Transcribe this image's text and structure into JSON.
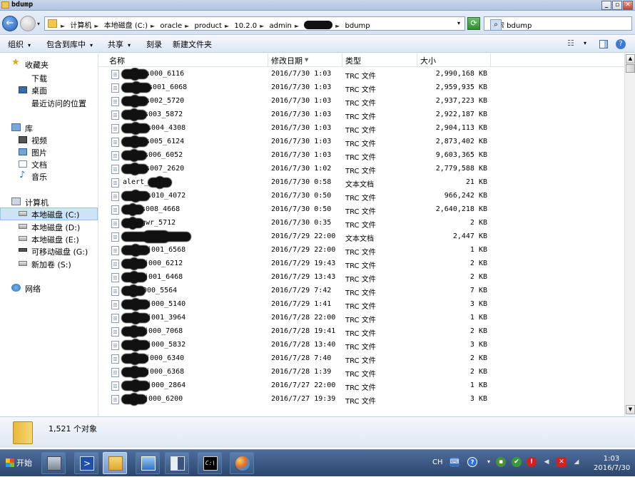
{
  "window": {
    "title": "bdump"
  },
  "address": {
    "crumbs": [
      "计算机",
      "本地磁盘 (C:)",
      "oracle",
      "product",
      "10.2.0",
      "admin",
      "",
      "bdump"
    ]
  },
  "search": {
    "placeholder": "搜索 bdump"
  },
  "toolbar": {
    "organize": "组织",
    "include_library": "包含到库中",
    "share": "共享",
    "burn": "刻录",
    "new_folder": "新建文件夹"
  },
  "sidebar": {
    "favorites": "收藏夹",
    "fav_items": [
      "下载",
      "桌面",
      "最近访问的位置"
    ],
    "libraries": "库",
    "lib_items": [
      "视频",
      "图片",
      "文档",
      "音乐"
    ],
    "computer": "计算机",
    "drives": [
      "本地磁盘 (C:)",
      "本地磁盘 (D:)",
      "本地磁盘 (E:)",
      "可移动磁盘 (G:)",
      "新加卷 (S:)"
    ],
    "network": "网络"
  },
  "columns": {
    "name": "名称",
    "date": "修改日期",
    "type": "类型",
    "size": "大小"
  },
  "files": [
    {
      "name": "s000_6116",
      "date": "2016/7/30 1:03",
      "type": "TRC 文件",
      "size": "2,990,168 KB"
    },
    {
      "name": "s001_6068",
      "date": "2016/7/30 1:03",
      "type": "TRC 文件",
      "size": "2,959,935 KB"
    },
    {
      "name": "s002_5720",
      "date": "2016/7/30 1:03",
      "type": "TRC 文件",
      "size": "2,937,223 KB"
    },
    {
      "name": "s003_5872",
      "date": "2016/7/30 1:03",
      "type": "TRC 文件",
      "size": "2,922,187 KB"
    },
    {
      "name": "s004_4308",
      "date": "2016/7/30 1:03",
      "type": "TRC 文件",
      "size": "2,904,113 KB"
    },
    {
      "name": "s005_6124",
      "date": "2016/7/30 1:03",
      "type": "TRC 文件",
      "size": "2,873,402 KB"
    },
    {
      "name": "s006_6052",
      "date": "2016/7/30 1:03",
      "type": "TRC 文件",
      "size": "9,603,365 KB"
    },
    {
      "name": "s007_2620",
      "date": "2016/7/30 1:02",
      "type": "TRC 文件",
      "size": "2,779,588 KB"
    },
    {
      "name": "alert_",
      "date": "2016/7/30 0:58",
      "type": "文本文档",
      "size": "21 KB"
    },
    {
      "name": "s010_4072",
      "date": "2016/7/30 0:50",
      "type": "TRC 文件",
      "size": "966,242 KB"
    },
    {
      "name": "s008_4668",
      "date": "2016/7/30 0:50",
      "type": "TRC 文件",
      "size": "2,640,218 KB"
    },
    {
      "name": "gwr_5712",
      "date": "2016/7/30 0:35",
      "type": "TRC 文件",
      "size": "2 KB"
    },
    {
      "name": "",
      "date": "2016/7/29 22:00",
      "type": "文本文档",
      "size": "2,447 KB"
    },
    {
      "name": "j001_6568",
      "date": "2016/7/29 22:00",
      "type": "TRC 文件",
      "size": "1 KB"
    },
    {
      "name": "j000_6212",
      "date": "2016/7/29 19:43",
      "type": "TRC 文件",
      "size": "2 KB"
    },
    {
      "name": "j001_6468",
      "date": "2016/7/29 13:43",
      "type": "TRC 文件",
      "size": "2 KB"
    },
    {
      "name": "000_5564",
      "date": "2016/7/29 7:42",
      "type": "TRC 文件",
      "size": "7 KB"
    },
    {
      "name": "j000_5140",
      "date": "2016/7/29 1:41",
      "type": "TRC 文件",
      "size": "3 KB"
    },
    {
      "name": "j001_3964",
      "date": "2016/7/28 22:00",
      "type": "TRC 文件",
      "size": "1 KB"
    },
    {
      "name": "j000_7068",
      "date": "2016/7/28 19:41",
      "type": "TRC 文件",
      "size": "2 KB"
    },
    {
      "name": "j000_5832",
      "date": "2016/7/28 13:40",
      "type": "TRC 文件",
      "size": "3 KB"
    },
    {
      "name": "j000_6340",
      "date": "2016/7/28 7:40",
      "type": "TRC 文件",
      "size": "2 KB"
    },
    {
      "name": "j000_6368",
      "date": "2016/7/28 1:39",
      "type": "TRC 文件",
      "size": "2 KB"
    },
    {
      "name": "j000_2864",
      "date": "2016/7/27 22:00",
      "type": "TRC 文件",
      "size": "1 KB"
    },
    {
      "name": "j000_6200",
      "date": "2016/7/27 19:39",
      "type": "TRC 文件",
      "size": "3 KB"
    }
  ],
  "status": {
    "count": "1,521 个对象"
  },
  "taskbar": {
    "start": "开始",
    "lang": "CH",
    "time": "1:03",
    "date": "2016/7/30"
  },
  "colors": {
    "selection": "#cde3f8",
    "taskbar": "#2b466f",
    "accent": "#245bb3"
  }
}
